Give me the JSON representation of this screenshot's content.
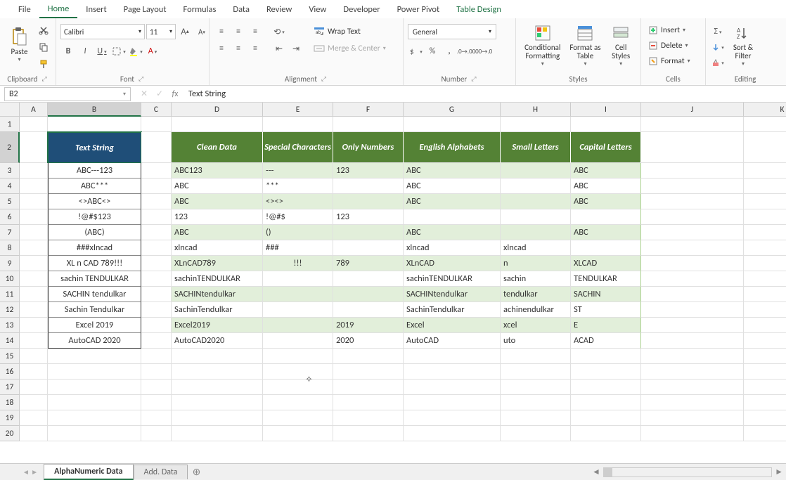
{
  "ribbon": {
    "tabs": [
      "File",
      "Home",
      "Insert",
      "Page Layout",
      "Formulas",
      "Data",
      "Review",
      "View",
      "Developer",
      "Power Pivot",
      "Table Design"
    ],
    "active_tab": "Home",
    "clipboard": {
      "paste": "Paste",
      "label": "Clipboard"
    },
    "font": {
      "name": "Calibri",
      "size": "11",
      "label": "Font"
    },
    "alignment": {
      "wrap": "Wrap Text",
      "merge": "Merge & Center",
      "label": "Alignment"
    },
    "number": {
      "format": "General",
      "label": "Number"
    },
    "styles": {
      "cond": "Conditional Formatting",
      "fat": "Format as Table",
      "cell": "Cell Styles",
      "label": "Styles"
    },
    "cells": {
      "insert": "Insert",
      "delete": "Delete",
      "format": "Format",
      "label": "Cells"
    },
    "editing": {
      "sort": "Sort & Filter",
      "label": "Editing"
    }
  },
  "formula_bar": {
    "name_box": "B2",
    "formula": "Text String"
  },
  "columns": [
    "A",
    "B",
    "C",
    "D",
    "E",
    "F",
    "G",
    "H",
    "I",
    "J",
    "K"
  ],
  "rows": [
    "1",
    "2",
    "3",
    "4",
    "5",
    "6",
    "7",
    "8",
    "9",
    "10",
    "11",
    "12",
    "13",
    "14",
    "15",
    "16",
    "17",
    "18",
    "19",
    "20"
  ],
  "selected_cell": "B2",
  "b_header": "Text String",
  "input_strings": [
    "ABC---123",
    "ABC***",
    "<>ABC<>",
    "!@#$123",
    "(ABC)",
    "###xlncad",
    "XL n CAD 789!!!",
    "sachin TENDULKAR",
    "SACHIN tendulkar",
    "Sachin Tendulkar",
    "Excel 2019",
    "AutoCAD 2020"
  ],
  "table_headers": [
    "Clean Data",
    "Special Characters",
    "Only Numbers",
    "English Alphabets",
    "Small Letters",
    "Capital Letters"
  ],
  "table_data": [
    [
      "ABC123",
      "---",
      "123",
      "ABC",
      "",
      "ABC"
    ],
    [
      "ABC",
      "***",
      "",
      "ABC",
      "",
      "ABC"
    ],
    [
      "ABC",
      "<><>",
      "",
      "ABC",
      "",
      "ABC"
    ],
    [
      "123",
      "!@#$",
      "123",
      "",
      "",
      ""
    ],
    [
      "ABC",
      "()",
      "",
      "ABC",
      "",
      "ABC"
    ],
    [
      "xlncad",
      "###",
      "",
      "xlncad",
      "xlncad",
      ""
    ],
    [
      "XLnCAD789",
      "!!!",
      "789",
      "XLnCAD",
      "n",
      "XLCAD"
    ],
    [
      "sachinTENDULKAR",
      "",
      "",
      "sachinTENDULKAR",
      "sachin",
      "TENDULKAR"
    ],
    [
      "SACHINtendulkar",
      "",
      "",
      "SACHINtendulkar",
      "tendulkar",
      "SACHIN"
    ],
    [
      "SachinTendulkar",
      "",
      "",
      "SachinTendulkar",
      "achinendulkar",
      "ST"
    ],
    [
      "Excel2019",
      "",
      "2019",
      "Excel",
      "xcel",
      "E"
    ],
    [
      "AutoCAD2020",
      "",
      "2020",
      "AutoCAD",
      "uto",
      "ACAD"
    ]
  ],
  "sheets": {
    "active": "AlphaNumeric Data",
    "other": "Add. Data"
  }
}
